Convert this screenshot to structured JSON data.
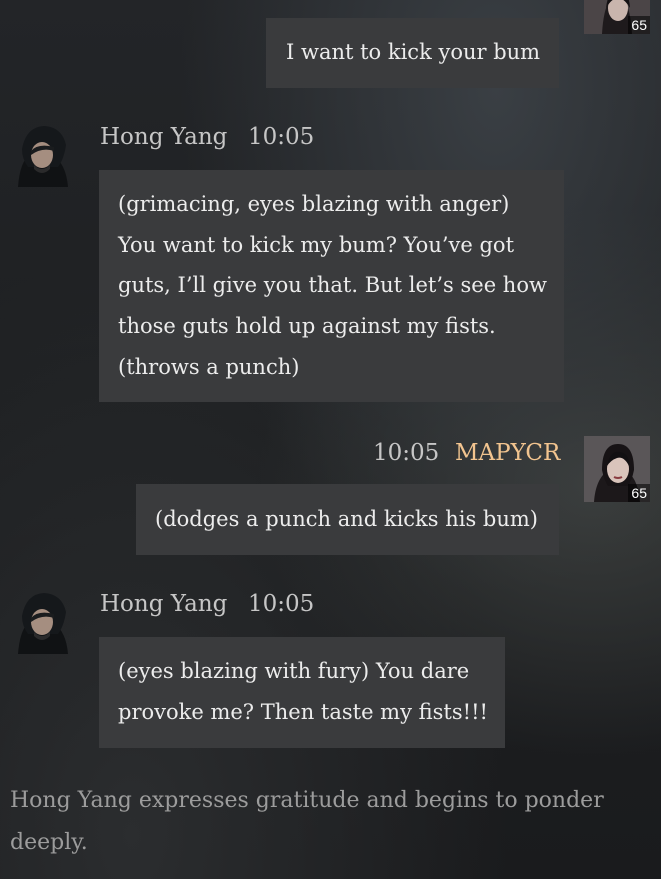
{
  "messages": [
    {
      "sender": "",
      "level": "65",
      "text": "I want to kick your bum"
    },
    {
      "sender": "Hong Yang",
      "time": "10:05",
      "lines": [
        "(grimacing, eyes blazing with anger)",
        "You want to kick my bum? You’ve got",
        "guts, I’ll give you that. But let’s see how",
        "those guts hold up against my fists.",
        "(throws a punch)"
      ]
    },
    {
      "sender": "MAPYCR",
      "time": "10:05",
      "level": "65",
      "text": "(dodges a punch and kicks his bum)"
    },
    {
      "sender": "Hong Yang",
      "time": "10:05",
      "lines": [
        "(eyes blazing with fury) You dare",
        "provoke me? Then taste my fists!!!"
      ]
    }
  ],
  "system_message": "Hong Yang expresses gratitude and begins to ponder deeply.",
  "colors": {
    "bubble": "#3a3b3d",
    "player_name": "#f2c48f",
    "npc_name": "#c6c6c6",
    "system": "#9c9c9c"
  },
  "icons": {
    "npc_avatar": "hooded-swordsman-portrait",
    "player_avatar": "female-warrior-portrait"
  }
}
